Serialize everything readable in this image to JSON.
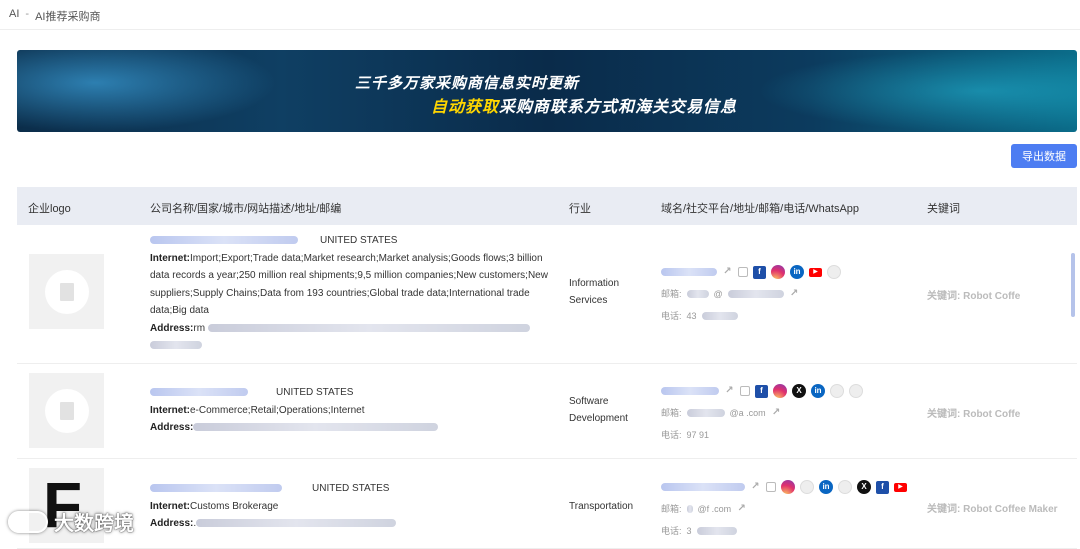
{
  "breadcrumb": {
    "root": "AI",
    "sep": "-",
    "current": "AI推荐采购商"
  },
  "banner": {
    "line1": "三千多万家采购商信息实时更新",
    "line2_highlight": "自动获取",
    "line2_rest": "采购商联系方式和海关交易信息"
  },
  "toolbar": {
    "export_label": "导出数据"
  },
  "table": {
    "headers": [
      "企业logo",
      "公司名称/国家/城市/网站描述/地址/邮编",
      "行业",
      "域名/社交平台/地址/邮箱/电话/WhatsApp",
      "关键词"
    ],
    "rows": [
      {
        "country": "UNITED STATES",
        "internet_label": "Internet:",
        "internet_value": "Import;Export;Trade data;Market research;Market analysis;Goods flows;3 billion data records a year;250 million real shipments;9,5 million companies;New customers;New suppliers;Supply Chains;Data from 193 countries;Global trade data;International trade data;Big data",
        "address_label": "Address:",
        "address_value": "rm",
        "industry": "Information Services",
        "email_label": "邮箱:",
        "email_value": "@",
        "phone_label": "电话:",
        "phone_value": "43",
        "keyword": "关键词: Robot Coffe"
      },
      {
        "country": "UNITED STATES",
        "internet_label": "Internet:",
        "internet_value": "e-Commerce;Retail;Operations;Internet",
        "address_label": "Address:",
        "address_value": "",
        "industry": "Software Development",
        "email_label": "邮箱:",
        "email_value": "@a                .com",
        "phone_label": "电话:",
        "phone_value": "97                    91",
        "keyword": "关键词: Robot Coffe"
      },
      {
        "logo_text": "F",
        "country": "UNITED STATES",
        "internet_label": "Internet:",
        "internet_value": "Customs Brokerage",
        "address_label": "Address:",
        "address_value": ".",
        "industry": "Transportation",
        "email_label": "邮箱:",
        "email_value": "@f                .com",
        "phone_label": "电话:",
        "phone_value": "3",
        "keyword": "关键词: Robot Coffee Maker"
      }
    ]
  },
  "icons": {
    "facebook": "f",
    "linkedin": "in",
    "x": "X",
    "youtube": "▶",
    "external": "↗"
  },
  "watermark": {
    "text": "大数跨境"
  }
}
